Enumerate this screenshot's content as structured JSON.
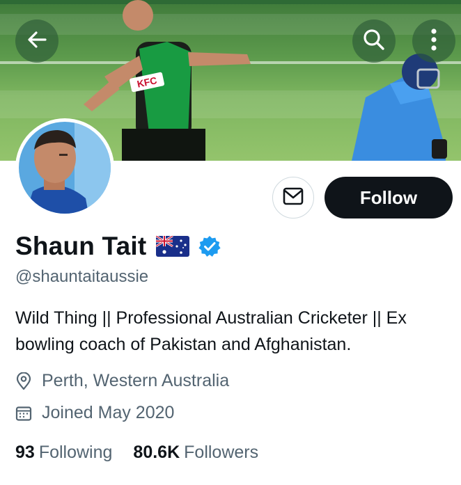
{
  "profile": {
    "name": "Shaun Tait",
    "flag_emoji": "🇦🇺",
    "handle": "@shauntaitaussie",
    "bio": "Wild Thing || Professional Australian Cricketer || Ex bowling coach of Pakistan and Afghanistan.",
    "location": "Perth, Western Australia",
    "joined": "Joined May 2020",
    "following_count": "93",
    "following_label": "Following",
    "followers_count": "80.6K",
    "followers_label": "Followers",
    "verified": true
  },
  "banner": {
    "jersey_sponsor": "KFC",
    "icons": [
      "back-arrow-icon",
      "search-icon",
      "more-vertical-icon"
    ]
  },
  "actions": {
    "follow_label": "Follow",
    "message_icon": "mail-icon"
  },
  "colors": {
    "verified_blue": "#1d9bf0",
    "follow_bg": "#0f1419",
    "secondary_text": "#536471",
    "pitch_green": "#5c9a4c"
  }
}
